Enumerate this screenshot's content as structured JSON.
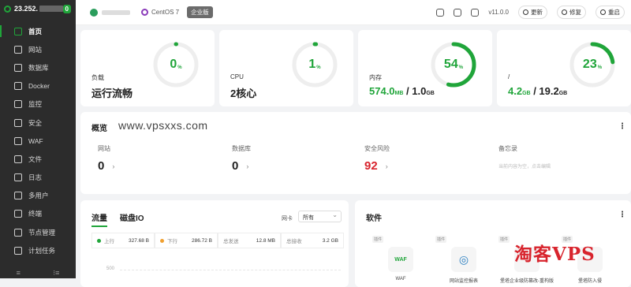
{
  "sidebar": {
    "ip": "23.252.",
    "badge": "0",
    "items": [
      {
        "label": "首页",
        "icon": "home-icon",
        "active": true
      },
      {
        "label": "网站",
        "icon": "globe-icon"
      },
      {
        "label": "数据库",
        "icon": "database-icon"
      },
      {
        "label": "Docker",
        "icon": "docker-icon"
      },
      {
        "label": "监控",
        "icon": "monitor-icon"
      },
      {
        "label": "安全",
        "icon": "shield-icon"
      },
      {
        "label": "WAF",
        "icon": "waf-icon"
      },
      {
        "label": "文件",
        "icon": "folder-icon"
      },
      {
        "label": "日志",
        "icon": "log-icon"
      },
      {
        "label": "多用户",
        "icon": "users-icon"
      },
      {
        "label": "终端",
        "icon": "terminal-icon"
      },
      {
        "label": "节点管理",
        "icon": "nodes-icon"
      },
      {
        "label": "计划任务",
        "icon": "calendar-icon"
      }
    ],
    "foot_left": "≡",
    "foot_right": "⁝≡"
  },
  "topbar": {
    "os": "CentOS 7",
    "edition": "企业版",
    "version": "v11.0.0",
    "update": "更新",
    "repair": "修复",
    "restart": "重启"
  },
  "stats": {
    "load": {
      "label": "负载",
      "status": "运行流畅",
      "percent": "0"
    },
    "cpu": {
      "label": "CPU",
      "cores": "2核心",
      "percent": "1"
    },
    "mem": {
      "label": "内存",
      "used": "574.0",
      "used_unit": "MB",
      "total": "1.0",
      "total_unit": "GB",
      "percent": "54"
    },
    "disk": {
      "label": "/",
      "used": "4.2",
      "used_unit": "GB",
      "total": "19.2",
      "total_unit": "GB",
      "percent": "23"
    },
    "pct_unit": "%",
    "sep": " / "
  },
  "overview": {
    "title": "概览",
    "watermark": "www.vpsxxs.com",
    "more": "⋮",
    "site_label": "网站",
    "site_value": "0",
    "db_label": "数据库",
    "db_value": "0",
    "risk_label": "安全风险",
    "risk_value": "92",
    "memo_label": "备忘录",
    "memo_placeholder": "当前内容为空，点击编辑",
    "chev": "›"
  },
  "traffic": {
    "tab1": "流量",
    "tab2": "磁盘IO",
    "nic_label": "网卡",
    "nic_value": "所有",
    "up_label": "上行",
    "up_value": "327.68 B",
    "down_label": "下行",
    "down_value": "286.72 B",
    "sent_label": "总发送",
    "sent_value": "12.8 MB",
    "recv_label": "总接收",
    "recv_value": "3.2 GB",
    "axis_tick": "500",
    "colors": {
      "up": "#20a53a",
      "down": "#f0a030"
    }
  },
  "software": {
    "title": "软件",
    "more": "⋮",
    "items": [
      {
        "tag": "插件",
        "name": "WAF",
        "icon": "WAF"
      },
      {
        "tag": "插件",
        "name": "网站监控报表",
        "icon": "◎"
      },
      {
        "tag": "插件",
        "name": "堡塔企业级防篡改-重构版",
        "icon": ""
      },
      {
        "tag": "插件",
        "name": "堡塔防入侵",
        "icon": ""
      }
    ]
  },
  "watermark2": "淘客VPS",
  "colors": {
    "accent": "#20a53a",
    "danger": "#d8242d",
    "sidebar": "#2c2c2c"
  }
}
